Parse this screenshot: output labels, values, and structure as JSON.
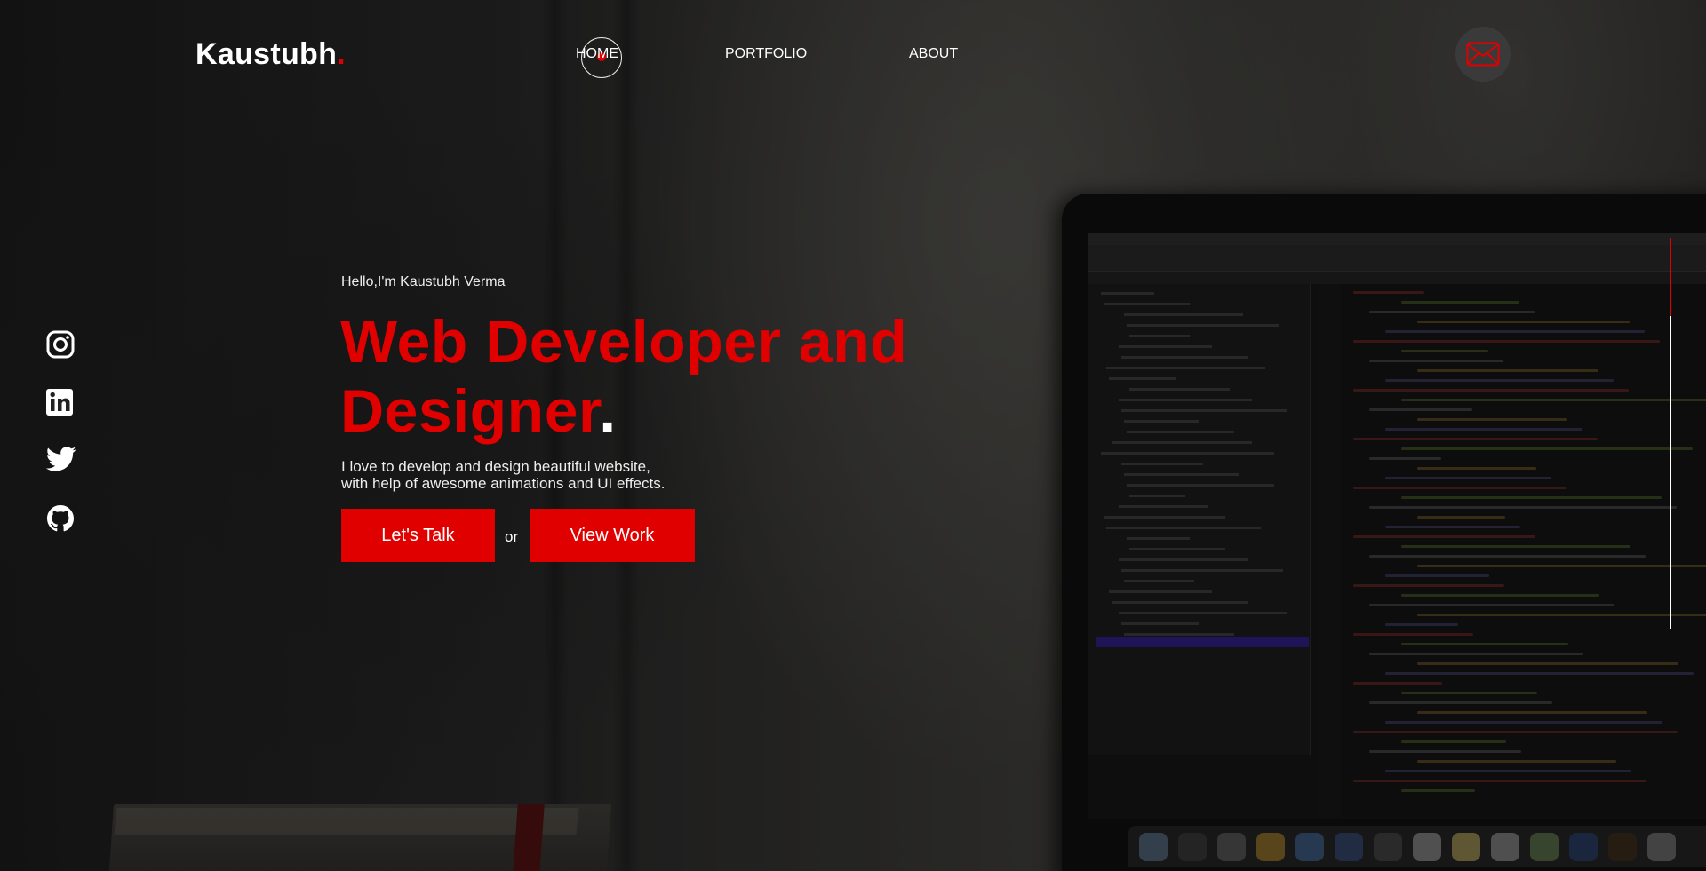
{
  "header": {
    "logo_text": "Kaustubh",
    "logo_dot": ".",
    "nav": [
      {
        "label": "HOME"
      },
      {
        "label": "PORTFOLIO"
      },
      {
        "label": "ABOUT"
      }
    ],
    "active_nav": "HOME"
  },
  "social": {
    "items": [
      "instagram-icon",
      "linkedin-icon",
      "twitter-icon",
      "github-icon"
    ]
  },
  "hero": {
    "greeting": "Hello,I'm Kaustubh Verma",
    "headline_line1": "Web Developer and",
    "headline_line2": "Designer",
    "headline_dot": ".",
    "desc_line1": "I love to develop and design beautiful website,",
    "desc_line2": "with help of awesome animations and UI effects.",
    "btn_talk": "Let's Talk",
    "or": "or",
    "btn_work": "View Work"
  },
  "icons": {
    "mail": "mail-icon"
  },
  "colors": {
    "accent": "#e00000",
    "text": "#ffffff",
    "background": "#222222"
  }
}
